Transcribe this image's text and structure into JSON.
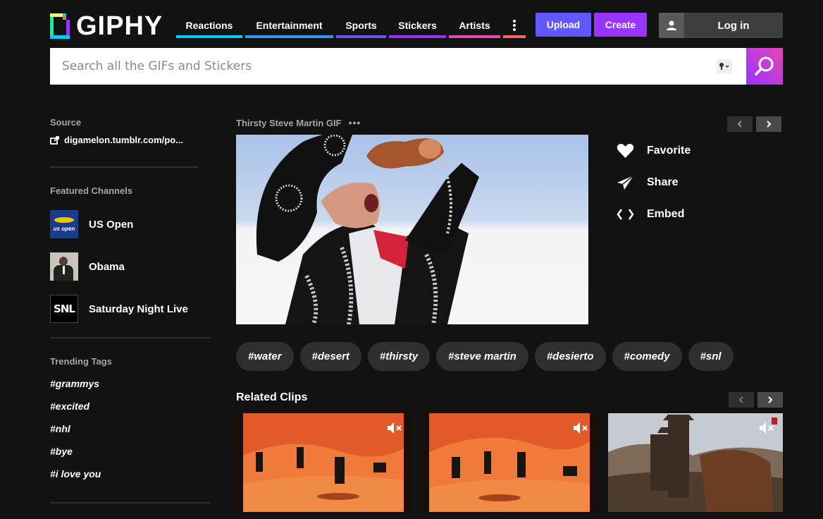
{
  "header": {
    "logo_text": "GIPHY",
    "nav": [
      {
        "label": "Reactions",
        "color": "#00ccff"
      },
      {
        "label": "Entertainment",
        "color": "#3399ff"
      },
      {
        "label": "Sports",
        "color": "#6157ff"
      },
      {
        "label": "Stickers",
        "color": "#9933ff"
      },
      {
        "label": "Artists",
        "color": "#e646b6"
      }
    ],
    "more_color": "#ff6666",
    "upload_label": "Upload",
    "create_label": "Create",
    "login_label": "Log in"
  },
  "search": {
    "placeholder": "Search all the GIFs and Stickers",
    "value": ""
  },
  "sidebar": {
    "source_heading": "Source",
    "source_link": "digamelon.tumblr.com/po...",
    "channels_heading": "Featured Channels",
    "channels": [
      {
        "name": "US Open",
        "thumb_text": "us open"
      },
      {
        "name": "Obama"
      },
      {
        "name": "Saturday Night Live",
        "thumb_text": "SNL"
      }
    ],
    "trending_heading": "Trending Tags",
    "trending": [
      "#grammys",
      "#excited",
      "#nhl",
      "#bye",
      "#i love you"
    ]
  },
  "gif": {
    "title": "Thirsty Steve Martin GIF",
    "more": "•••",
    "actions": {
      "favorite": "Favorite",
      "share": "Share",
      "embed": "Embed"
    },
    "tags": [
      "#water",
      "#desert",
      "#thirsty",
      "#steve martin",
      "#desierto",
      "#comedy",
      "#snl"
    ]
  },
  "related": {
    "heading": "Related Clips"
  },
  "colors": {
    "background": "#121212",
    "upload": "#6157ff",
    "create": "#9933ff",
    "pill": "#2f2f2f"
  }
}
